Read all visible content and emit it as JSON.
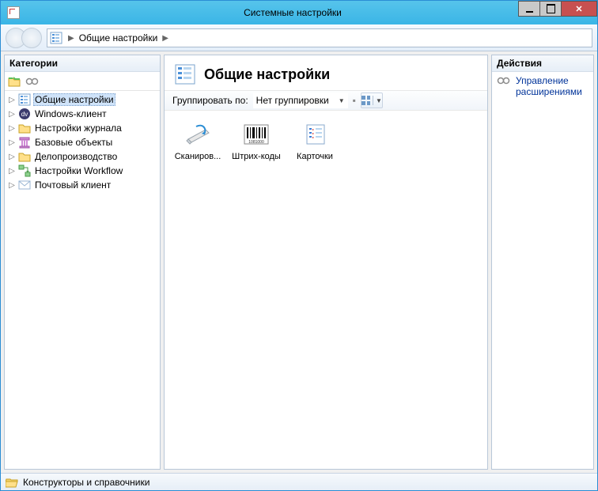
{
  "window": {
    "title": "Системные настройки"
  },
  "breadcrumb": {
    "item": "Общие настройки"
  },
  "left": {
    "title": "Категории",
    "tree": [
      {
        "label": "Общие настройки",
        "icon": "list",
        "selected": true
      },
      {
        "label": "Windows-клиент",
        "icon": "dv",
        "selected": false
      },
      {
        "label": "Настройки журнала",
        "icon": "folder",
        "selected": false
      },
      {
        "label": "Базовые объекты",
        "icon": "pillar",
        "selected": false
      },
      {
        "label": "Делопроизводство",
        "icon": "folder",
        "selected": false
      },
      {
        "label": "Настройки Workflow",
        "icon": "workflow",
        "selected": false
      },
      {
        "label": "Почтовый клиент",
        "icon": "mail",
        "selected": false
      }
    ]
  },
  "center": {
    "title": "Общие настройки",
    "group_label": "Группировать по:",
    "group_value": "Нет группировки",
    "items": [
      {
        "label": "Сканиров...",
        "icon": "scanner"
      },
      {
        "label": "Штрих-коды",
        "icon": "barcode"
      },
      {
        "label": "Карточки",
        "icon": "cards"
      }
    ]
  },
  "right": {
    "title": "Действия",
    "action_label": "Управление расширениями"
  },
  "statusbar": {
    "text": "Конструкторы и справочники"
  }
}
